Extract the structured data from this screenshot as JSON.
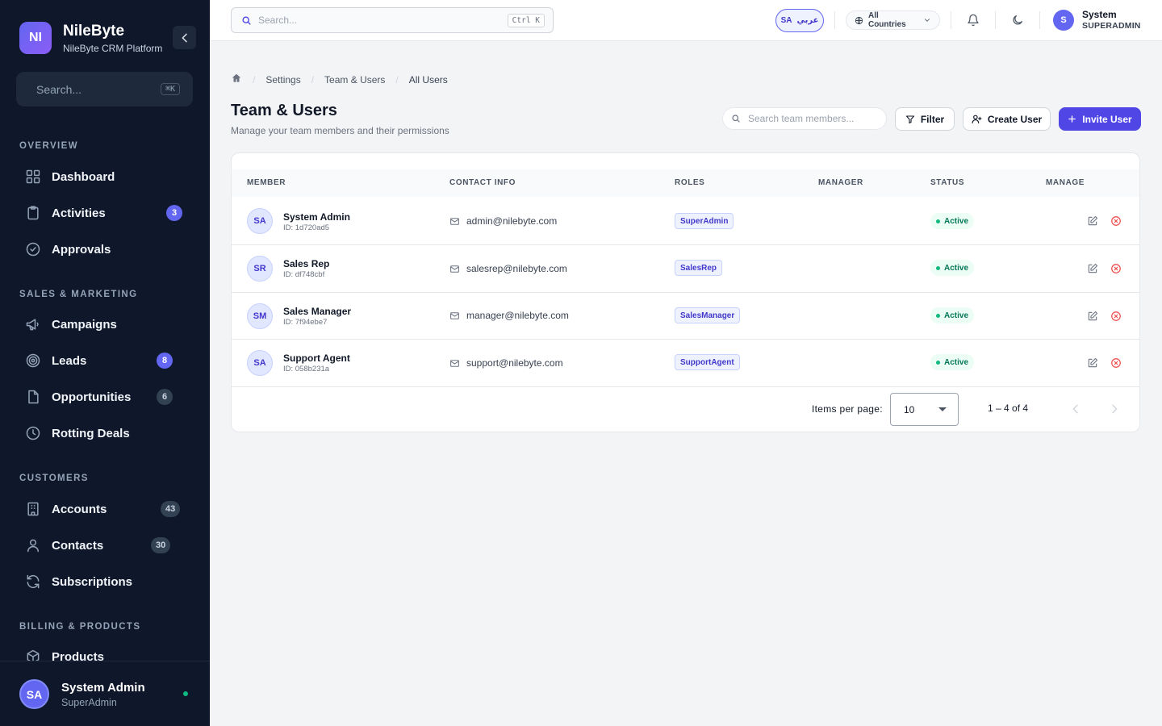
{
  "sidebar": {
    "brand": {
      "logo": "NI",
      "name": "NileByte",
      "subtitle": "NileByte CRM Platform"
    },
    "search": {
      "placeholder": "Search...",
      "shortcut": "⌘K"
    },
    "sections": {
      "overview": "OVERVIEW",
      "sales_marketing": "SALES & MARKETING",
      "customers": "CUSTOMERS",
      "billing_products": "BILLING & PRODUCTS"
    },
    "items": {
      "dashboard": {
        "label": "Dashboard",
        "icon": "grid-icon"
      },
      "activities": {
        "label": "Activities",
        "icon": "clipboard-icon",
        "badge": "3"
      },
      "approvals": {
        "label": "Approvals",
        "icon": "check-circle-icon"
      },
      "campaigns": {
        "label": "Campaigns",
        "icon": "megaphone-icon"
      },
      "leads": {
        "label": "Leads",
        "icon": "target-icon",
        "badge": "8"
      },
      "opportunities": {
        "label": "Opportunities",
        "icon": "file-icon",
        "badge": "6"
      },
      "rotting_deals": {
        "label": "Rotting Deals",
        "icon": "clock-icon"
      },
      "accounts": {
        "label": "Accounts",
        "icon": "building-icon",
        "badge": "43"
      },
      "contacts": {
        "label": "Contacts",
        "icon": "user-icon",
        "badge": "30"
      },
      "subscriptions": {
        "label": "Subscriptions",
        "icon": "refresh-icon"
      },
      "products": {
        "label": "Products",
        "icon": "box-icon"
      }
    },
    "user": {
      "initials": "SA",
      "name": "System Admin",
      "role": "SuperAdmin"
    }
  },
  "topbar": {
    "search": {
      "placeholder": "Search...",
      "shortcut": "Ctrl K"
    },
    "language": {
      "code": "SA",
      "label": "عربي"
    },
    "country": "All Countries",
    "user": {
      "initials": "S",
      "name": "System",
      "role": "SUPERADMIN"
    }
  },
  "breadcrumb": {
    "settings": "Settings",
    "team": "Team & Users",
    "current": "All Users"
  },
  "page": {
    "title": "Team & Users",
    "subtitle": "Manage your team members and their permissions",
    "search_placeholder": "Search team members...",
    "filter_label": "Filter",
    "create_label": "Create User",
    "invite_label": "Invite User"
  },
  "table": {
    "headers": {
      "member": "MEMBER",
      "contact": "CONTACT INFO",
      "roles": "ROLES",
      "manager": "MANAGER",
      "status": "STATUS",
      "manage": "MANAGE"
    },
    "rows": [
      {
        "initials": "SA",
        "name": "System Admin",
        "id": "ID: 1d720ad5",
        "email": "admin@nilebyte.com",
        "role": "SuperAdmin",
        "manager": "",
        "status": "Active"
      },
      {
        "initials": "SR",
        "name": "Sales Rep",
        "id": "ID: df748cbf",
        "email": "salesrep@nilebyte.com",
        "role": "SalesRep",
        "manager": "",
        "status": "Active"
      },
      {
        "initials": "SM",
        "name": "Sales Manager",
        "id": "ID: 7f94ebe7",
        "email": "manager@nilebyte.com",
        "role": "SalesManager",
        "manager": "",
        "status": "Active"
      },
      {
        "initials": "SA",
        "name": "Support Agent",
        "id": "ID: 058b231a",
        "email": "support@nilebyte.com",
        "role": "SupportAgent",
        "manager": "",
        "status": "Active"
      }
    ]
  },
  "pagination": {
    "label": "Items per page:",
    "per_page": "10",
    "range": "1 – 4 of 4"
  },
  "colors": {
    "sidebar_bg": "#0f172a",
    "accent": "#4f46e5",
    "active_green": "#10b981",
    "danger": "#ef4444"
  }
}
